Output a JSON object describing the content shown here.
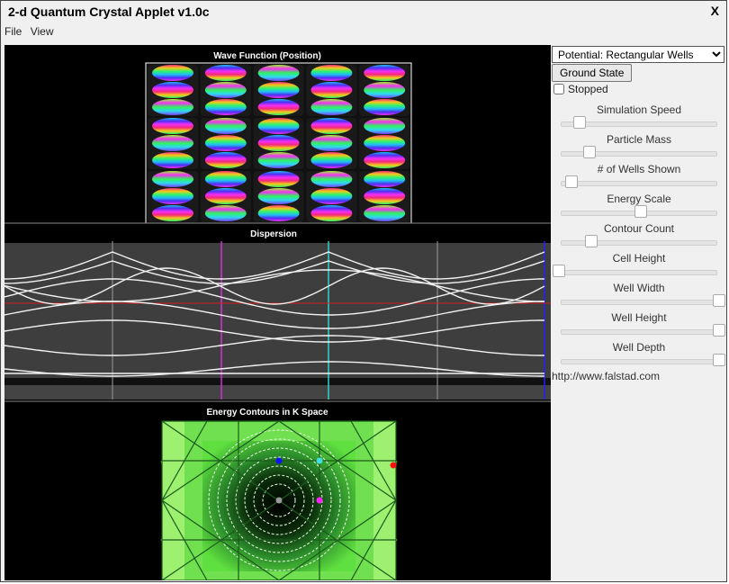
{
  "window": {
    "title": "2-d Quantum Crystal Applet v1.0c",
    "close_label": "X"
  },
  "menu": {
    "items": [
      "File",
      "View"
    ]
  },
  "canvas": {
    "wavefunction_title": "Wave Function (Position)",
    "dispersion_title": "Dispersion",
    "contours_title": "Energy Contours in K Space"
  },
  "controls": {
    "potential_selected": "Potential: Rectangular Wells",
    "ground_state_label": "Ground State",
    "stopped_label": "Stopped",
    "stopped_checked": false,
    "sliders": [
      {
        "label": "Simulation Speed",
        "value": 0.13
      },
      {
        "label": "Particle Mass",
        "value": 0.19
      },
      {
        "label": "# of Wells Shown",
        "value": 0.08
      },
      {
        "label": "Energy Scale",
        "value": 0.51
      },
      {
        "label": "Contour Count",
        "value": 0.2
      },
      {
        "label": "Cell Height",
        "value": 0.0
      },
      {
        "label": "Well Width",
        "value": 1.0
      },
      {
        "label": "Well Height",
        "value": 1.0
      },
      {
        "label": "Well Depth",
        "value": 1.0
      }
    ],
    "link_text": "http://www.falstad.com"
  },
  "colors": {
    "marker_blue": "#1010ff",
    "marker_cyan": "#40e0e0",
    "marker_red": "#ff1010",
    "marker_magenta": "#ff20ff",
    "marker_gray": "#999999"
  }
}
